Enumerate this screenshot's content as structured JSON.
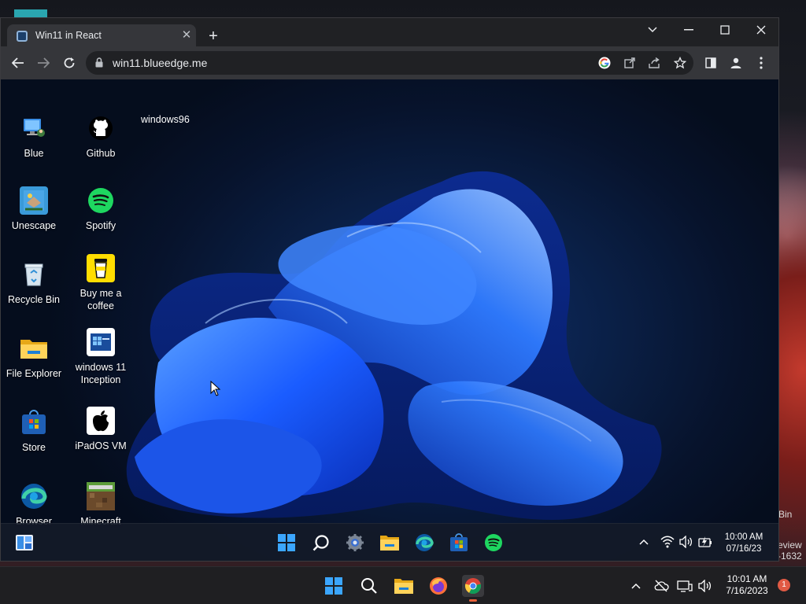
{
  "host": {
    "side_bin_text": "Bin",
    "side_review_text": "eview",
    "side_review_sub": "-1632",
    "taskbar": {
      "icons": [
        "windows-start-icon",
        "search-icon",
        "file-explorer-icon",
        "firefox-icon",
        "chrome-icon"
      ],
      "clock_time": "10:01 AM",
      "clock_date": "7/16/2023",
      "notification_count": "1"
    }
  },
  "browser": {
    "tab_title": "Win11 in React",
    "url": "win11.blueedge.me",
    "toolbar_icons": [
      "back-icon",
      "forward-icon",
      "reload-icon",
      "lock-icon",
      "google-icon",
      "open-external-icon",
      "share-icon",
      "bookmark-star-icon",
      "side-panel-icon",
      "profile-icon",
      "menu-dots-icon"
    ]
  },
  "desktop": {
    "icons_col1": [
      {
        "label": "Blue",
        "icon": "blue-pc-icon"
      },
      {
        "label": "Unescape",
        "icon": "unescape-icon"
      },
      {
        "label": "Recycle Bin",
        "icon": "recycle-bin-icon"
      },
      {
        "label": "File Explorer",
        "icon": "folder-icon"
      },
      {
        "label": "Store",
        "icon": "store-icon"
      },
      {
        "label": "Browser",
        "icon": "edge-icon"
      }
    ],
    "icons_col2": [
      {
        "label": "Github",
        "icon": "github-icon"
      },
      {
        "label": "Spotify",
        "icon": "spotify-icon"
      },
      {
        "label": "Buy me a coffee",
        "icon": "coffee-cup-icon"
      },
      {
        "label": "windows 11 Inception",
        "icon": "windows-11-icon"
      },
      {
        "label": "iPadOS VM",
        "icon": "apple-icon"
      },
      {
        "label": "Minecraft",
        "icon": "minecraft-icon"
      }
    ],
    "windows96_label": "windows96",
    "taskbar": {
      "clock_time": "10:00 AM",
      "clock_date": "07/16/23"
    }
  },
  "colors": {
    "win_blue": "#1a6fff",
    "chrome_dark": "#202124",
    "chrome_toolbar": "#35363a"
  }
}
